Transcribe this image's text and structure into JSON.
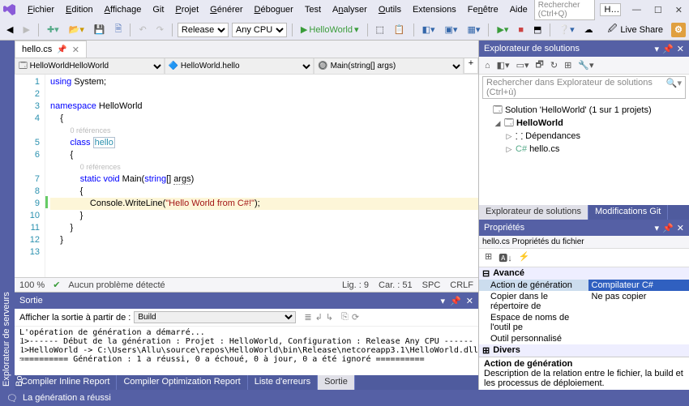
{
  "menubar": {
    "items": [
      "Fichier",
      "Edition",
      "Affichage",
      "Git",
      "Projet",
      "Générer",
      "Déboguer",
      "Test",
      "Analyser",
      "Outils",
      "Extensions",
      "Fenêtre",
      "Aide"
    ],
    "search_placeholder": "Rechercher (Ctrl+Q)",
    "solution_name": "Hell...orld"
  },
  "toolbar": {
    "config": "Release",
    "platform": "Any CPU",
    "start_label": "HelloWorld",
    "liveshare": "Live Share"
  },
  "side_tabs": [
    "Explorateur de serveurs",
    "Boîte à outils"
  ],
  "file_tab": {
    "name": "hello.cs"
  },
  "nav": {
    "project": "HelloWorld",
    "class": "HelloWorld.hello",
    "member": "Main(string[] args)"
  },
  "code": {
    "lines": [
      {
        "n": 1,
        "html": "<span class='kw'>using</span> System;"
      },
      {
        "n": 2,
        "html": ""
      },
      {
        "n": 3,
        "html": "<span class='kw'>namespace</span> HelloWorld"
      },
      {
        "n": 4,
        "html": "{",
        "indent": 1
      },
      {
        "n": "",
        "html": "<span class='refs'>0 références</span>",
        "indent": 2
      },
      {
        "n": 5,
        "html": "<span class='kw'>class</span> <span class='type boxed'>hello</span>",
        "indent": 2
      },
      {
        "n": 6,
        "html": "{",
        "indent": 2
      },
      {
        "n": "",
        "html": "<span class='refs'>0 références</span>",
        "indent": 3
      },
      {
        "n": 7,
        "html": "<span class='kw'>static</span> <span class='kw'>void</span> Main(<span class='kw'>string</span>[] <span style='border-bottom:1px dotted #888'>args</span>)",
        "indent": 3
      },
      {
        "n": 8,
        "html": "{",
        "indent": 3
      },
      {
        "n": 9,
        "html": "Console.WriteLine(<span class='str'>\"Hello World from C#!\"</span>);",
        "indent": 4,
        "hl": true,
        "mark": "green"
      },
      {
        "n": 10,
        "html": "}",
        "indent": 3
      },
      {
        "n": 11,
        "html": "}",
        "indent": 2
      },
      {
        "n": 12,
        "html": "}",
        "indent": 1
      },
      {
        "n": 13,
        "html": ""
      }
    ]
  },
  "editor_status": {
    "zoom": "100 %",
    "issues_icon": "✔",
    "issues": "Aucun problème détecté",
    "line_label": "Lig. :",
    "line": "9",
    "col_label": "Car. :",
    "col": "51",
    "ins": "SPC",
    "eol": "CRLF"
  },
  "output": {
    "title": "Sortie",
    "from_label": "Afficher la sortie à partir de :",
    "source": "Build",
    "body": "L'opération de génération a démarré...\n1>------ Début de la génération : Projet : HelloWorld, Configuration : Release Any CPU ------\n1>HelloWorld -> C:\\Users\\Allu\\source\\repos\\HelloWorld\\bin\\Release\\netcoreapp3.1\\HelloWorld.dll\n========== Génération : 1 a réussi, 0 a échoué, 0 à jour, 0 a été ignoré =========="
  },
  "bottom_tabs": [
    "Compiler Inline Report",
    "Compiler Optimization Report",
    "Liste d'erreurs",
    "Sortie"
  ],
  "statusbar": {
    "msg": "La génération a réussi"
  },
  "solution_explorer": {
    "title": "Explorateur de solutions",
    "search_placeholder": "Rechercher dans Explorateur de solutions (Ctrl+ù)",
    "root": "Solution 'HelloWorld' (1 sur 1 projets)",
    "project": "HelloWorld",
    "deps": "Dépendances",
    "file": "hello.cs",
    "tabs": [
      "Explorateur de solutions",
      "Modifications Git"
    ]
  },
  "properties": {
    "title": "Propriétés",
    "object": "hello.cs Propriétés du fichier",
    "cats": {
      "advanced": "Avancé",
      "rows_adv": [
        {
          "k": "Action de génération",
          "v": "Compilateur C#",
          "sel": true
        },
        {
          "k": "Copier dans le répertoire de",
          "v": "Ne pas copier"
        },
        {
          "k": "Espace de noms de l'outil pe",
          "v": ""
        },
        {
          "k": "Outil personnalisé",
          "v": ""
        }
      ],
      "misc": "Divers"
    },
    "desc_title": "Action de génération",
    "desc_body": "Description de la relation entre le fichier, la build et les processus de déploiement."
  }
}
